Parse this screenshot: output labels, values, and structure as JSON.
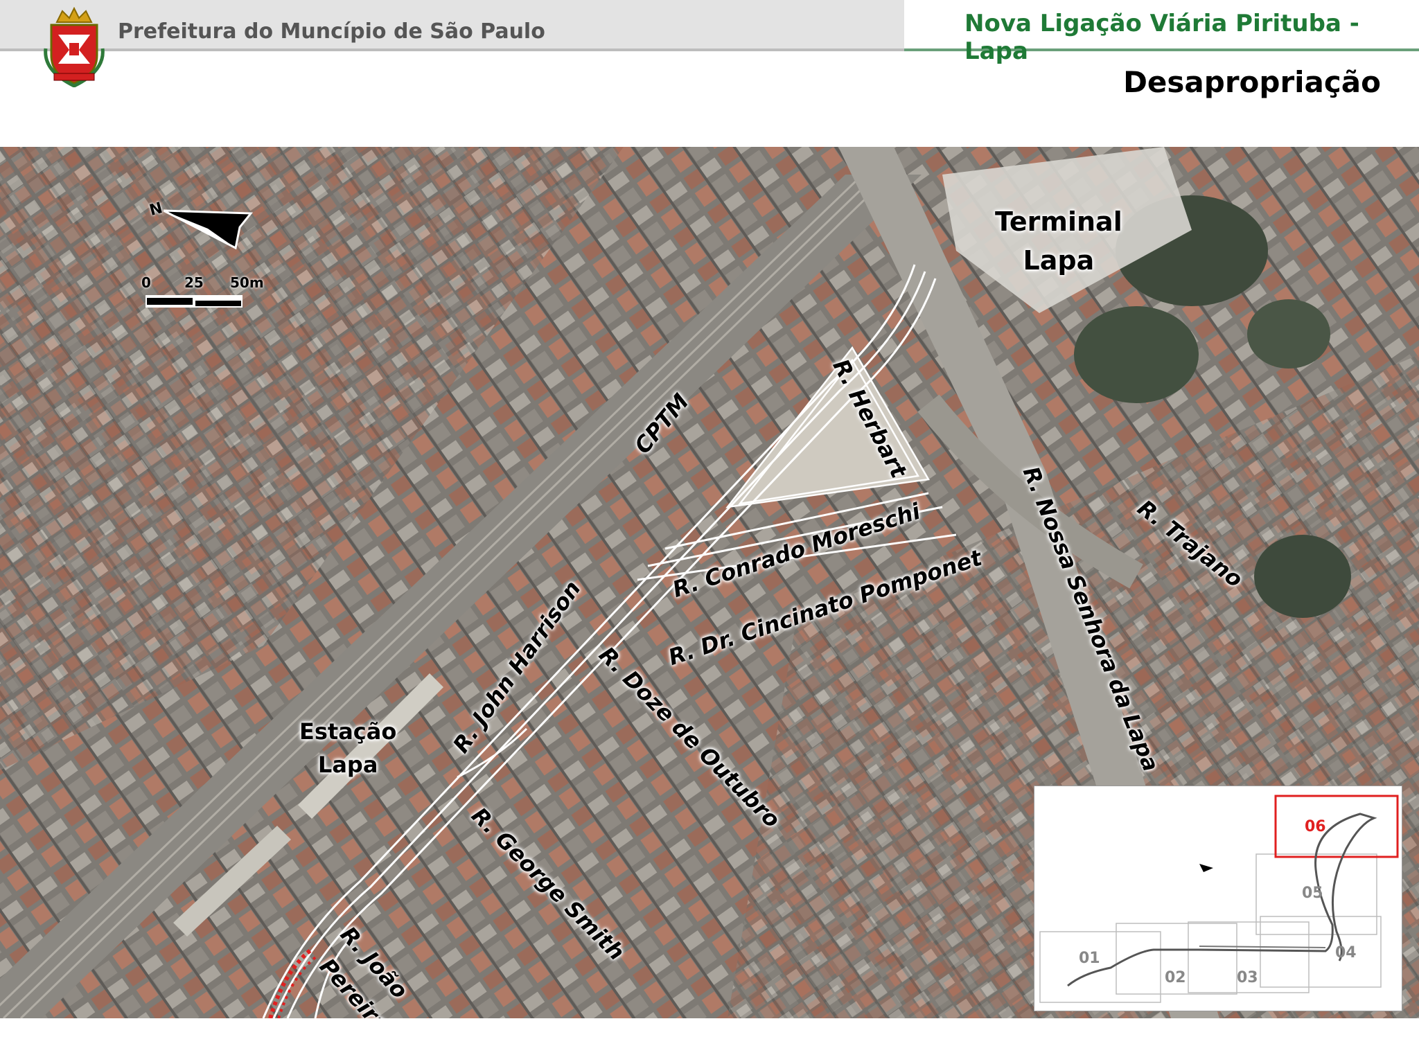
{
  "header": {
    "government": "Prefeitura do Muncípio de São Paulo",
    "project": "Nova Ligação Viária Pirituba - Lapa",
    "page_title": "Desapropriação"
  },
  "map": {
    "places": {
      "terminal_line1": "Terminal",
      "terminal_line2": "Lapa",
      "station_line1": "Estação",
      "station_line2": "Lapa",
      "cptm": "CPTM"
    },
    "streets": {
      "herbart": "R. Herbart",
      "conrado": "R. Conrado Moreschi",
      "cincinato": "R. Dr. Cincinato Pomponet",
      "john_harrison": "R. John Harrison",
      "doze_outubro": "R. Doze de Outubro",
      "george_smith": "R. George Smith",
      "joao_line1": "R. João",
      "joao_line2": "Pereira",
      "nossa_senhora": "R. Nossa Senhora da Lapa",
      "trajano": "R. Trajano"
    },
    "compass": {
      "label": "N",
      "icon": "north-arrow-icon"
    },
    "scale": {
      "tick_0": "0",
      "tick_25": "25",
      "tick_50": "50m"
    }
  },
  "inset": {
    "sections": [
      "01",
      "02",
      "03",
      "04",
      "05",
      "06"
    ],
    "active_section": "06",
    "colors": {
      "active": "#e02020",
      "inactive": "#888888"
    }
  },
  "colors": {
    "brand_green": "#1f7a36",
    "header_gray": "#e3e3e3",
    "highlight_red": "#e02020"
  }
}
